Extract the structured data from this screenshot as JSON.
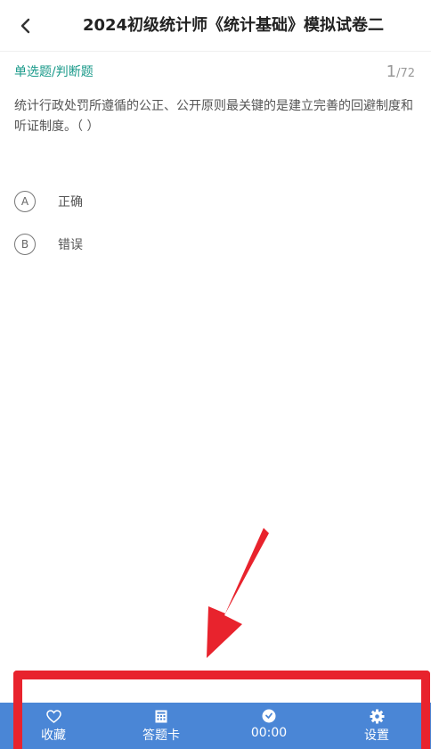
{
  "header": {
    "title": "2024初级统计师《统计基础》模拟试卷二",
    "back_icon": "chevron-left-icon"
  },
  "question": {
    "type_label": "单选题/判断题",
    "current": "1",
    "total": "/72",
    "text": "统计行政处罚所遵循的公正、公开原则最关键的是建立完善的回避制度和听证制度。（  ）",
    "options": [
      {
        "letter": "A",
        "text": "正确"
      },
      {
        "letter": "B",
        "text": "错误"
      }
    ]
  },
  "bottom_bar": {
    "favorite": {
      "label": "收藏",
      "icon": "heart-icon"
    },
    "answer_card": {
      "label": "答题卡",
      "icon": "grid-icon"
    },
    "timer": {
      "label": "00:00",
      "icon": "clock-icon"
    },
    "settings": {
      "label": "设置",
      "icon": "gear-icon"
    }
  },
  "colors": {
    "accent": "#1a9a8a",
    "bottom_bar": "#4a86d6",
    "annotation_red": "#e8232d"
  }
}
